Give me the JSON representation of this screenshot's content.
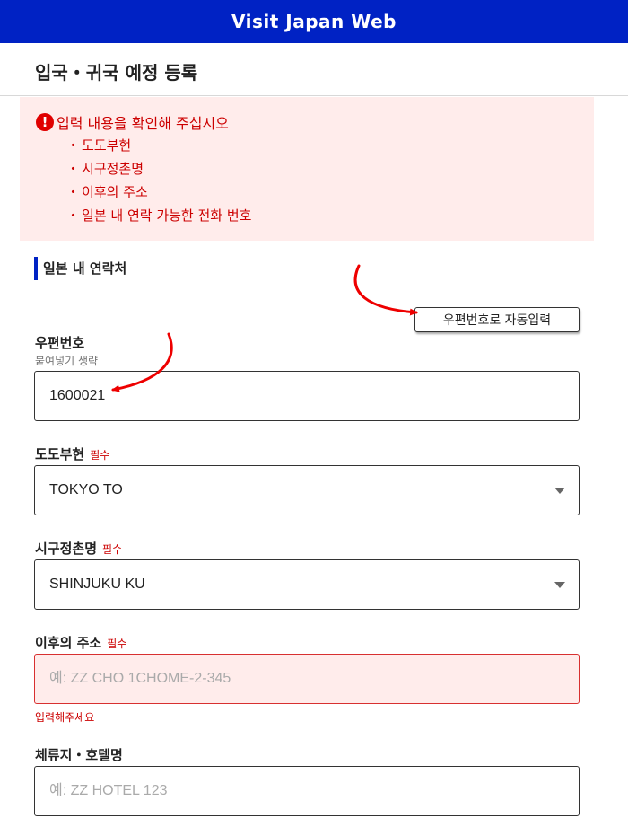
{
  "app": {
    "title": "Visit Japan Web"
  },
  "page": {
    "title": "입국・귀국 예정 등록"
  },
  "error_summary": {
    "heading": "입력 내용을 확인해 주십시오",
    "items": [
      "도도부현",
      "시구정촌명",
      "이후의 주소",
      "일본 내 연락 가능한 전화 번호"
    ]
  },
  "section": {
    "title": "일본 내 연락처"
  },
  "auto_fill_button": "우편번호로 자동입력",
  "postal_code": {
    "label": "우편번호",
    "hint": "붙여넣기 생략",
    "value": "1600021"
  },
  "prefecture": {
    "label": "도도부현",
    "required": "필수",
    "value": "TOKYO TO"
  },
  "city": {
    "label": "시구정촌명",
    "required": "필수",
    "value": "SHINJUKU KU"
  },
  "address": {
    "label": "이후의 주소",
    "required": "필수",
    "placeholder": "예: ZZ CHO 1CHOME-2-345",
    "error": "입력해주세요"
  },
  "hotel": {
    "label": "체류지・호텔명",
    "placeholder": "예: ZZ HOTEL 123"
  },
  "colors": {
    "brand": "#0022c4",
    "error": "#cc0000",
    "error_bg": "#ffeceb",
    "annotation_arrow": "#ee0000"
  },
  "icons": {
    "error": "exclamation-circle-icon",
    "dropdown": "caret-down-icon"
  }
}
